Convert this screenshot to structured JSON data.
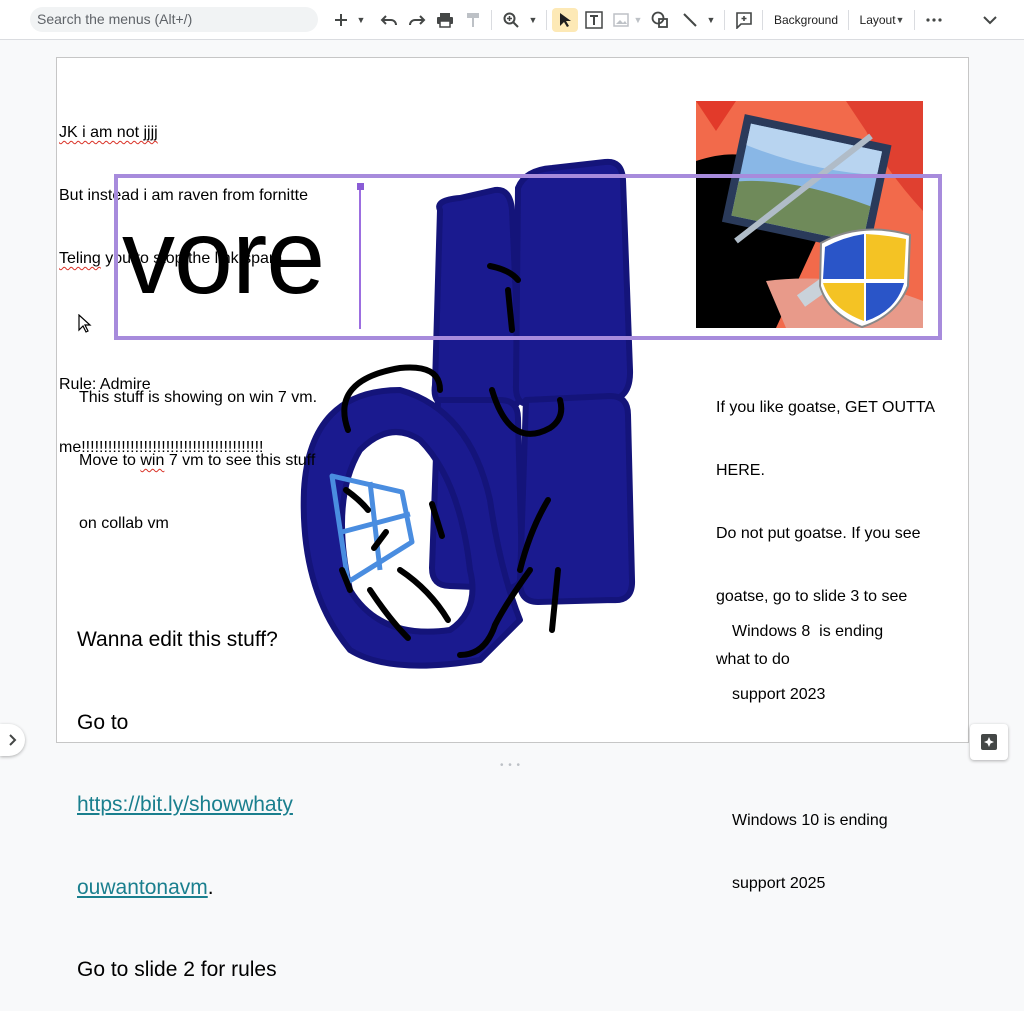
{
  "toolbar": {
    "search_placeholder": "Search the menus (Alt+/)",
    "icons": [
      "add-icon",
      "dropdown-icon",
      "undo-icon",
      "redo-icon",
      "print-icon",
      "paint-format-icon",
      "zoom-icon",
      "select-icon",
      "textbox-icon",
      "image-icon",
      "shape-icon",
      "line-icon",
      "comment-icon",
      "more-icon",
      "collapse-icon"
    ],
    "background_label": "Background",
    "layout_label": "Layout",
    "active_tool": "select-icon"
  },
  "slide": {
    "top_note": {
      "line1": "JK i am not jjjj",
      "line2": "But instead i am raven from fornitte",
      "line3_prefix": "",
      "line3_misspelled": "Teling",
      "line3_suffix": " you to stop the link spam",
      "line4": "",
      "line5": "Rule: Admire",
      "line6": "me!!!!!!!!!!!!!!!!!!!!!!!!!!!!!!!!!!!!!!!!!"
    },
    "big_word": "vore",
    "win7_note": {
      "line1": "This stuff is showing on win 7 vm.",
      "line2_prefix": "Move to ",
      "line2_misspelled": "win",
      "line2_suffix": " 7 vm to see this stuff",
      "line3": "on collab vm"
    },
    "goatse_note": {
      "line1": "If you like goatse, GET OUTTA",
      "line2": "HERE.",
      "line3": "Do not put goatse. If you see",
      "line4": "goatse, go to slide 3 to see",
      "line5": "what to do"
    },
    "edit_note": {
      "line1": "Wanna edit this stuff?",
      "line2": "Go to",
      "link_part1": "https://bit.ly/showwhaty",
      "link_part2": "ouwantonavm",
      "link_suffix": ".",
      "line5": "Go to slide 2 for rules"
    },
    "support_note": {
      "line1": "Windows 8  is ending",
      "line2": "support 2023",
      "line3": "",
      "line4": "Windows 10 is ending",
      "line5": "support 2025"
    }
  },
  "colors": {
    "accent_selection": "#a78bdc",
    "link": "#1a7f8e",
    "scribble_blue": "#1a1a8f",
    "scribble_light_blue": "#4a8de0"
  }
}
